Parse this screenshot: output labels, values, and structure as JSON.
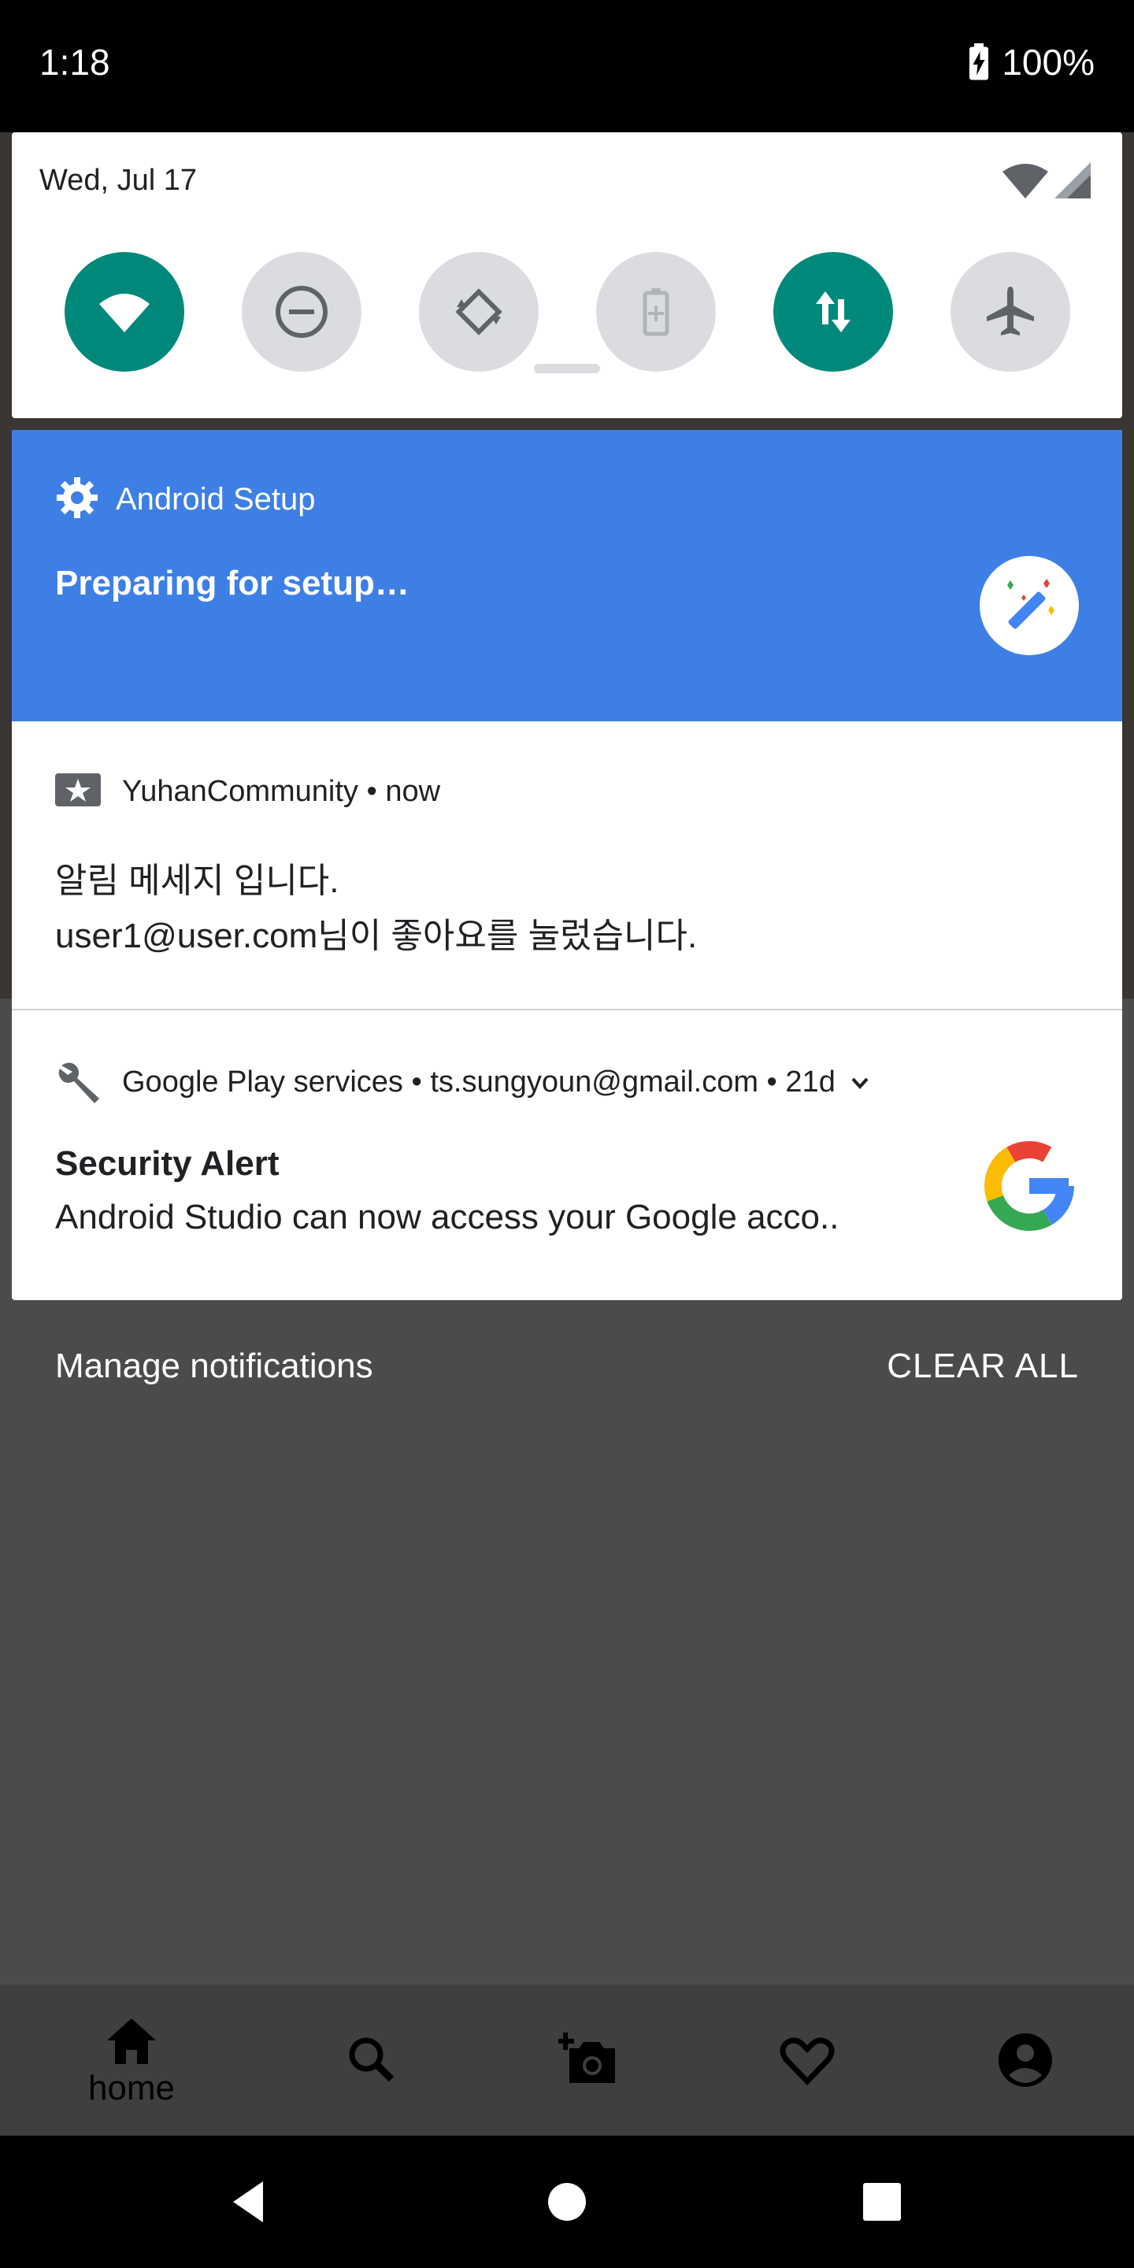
{
  "status_bar": {
    "time": "1:18",
    "battery": "100%"
  },
  "quick_settings": {
    "date": "Wed, Jul 17",
    "tiles": [
      {
        "name": "wifi-icon",
        "state": "on"
      },
      {
        "name": "do-not-disturb-icon",
        "state": "off"
      },
      {
        "name": "auto-rotate-icon",
        "state": "off"
      },
      {
        "name": "battery-saver-icon",
        "state": "off"
      },
      {
        "name": "mobile-data-icon",
        "state": "on"
      },
      {
        "name": "airplane-mode-icon",
        "state": "off"
      }
    ],
    "accent": "#00897b"
  },
  "notifications": {
    "setup": {
      "app": "Android Setup",
      "title": "Preparing for setup…",
      "color": "#3d7fe5"
    },
    "yuhan": {
      "header": "YuhanCommunity • now",
      "line1": "알림 메세지 입니다.",
      "line2": "user1@user.com님이 좋아요를 눌렀습니다."
    },
    "gps": {
      "header": "Google Play services • ts.sungyoun@gmail.com • 21d",
      "title": "Security Alert",
      "body": "Android Studio can now access your Google acco.."
    }
  },
  "actions": {
    "manage": "Manage notifications",
    "clear_all": "CLEAR ALL"
  },
  "app_nav": {
    "home_label": "home",
    "items": [
      "home-icon",
      "search-icon",
      "add-photo-icon",
      "heart-icon",
      "account-icon"
    ]
  },
  "system_nav": [
    "back-icon",
    "home-circle-icon",
    "recents-icon"
  ]
}
